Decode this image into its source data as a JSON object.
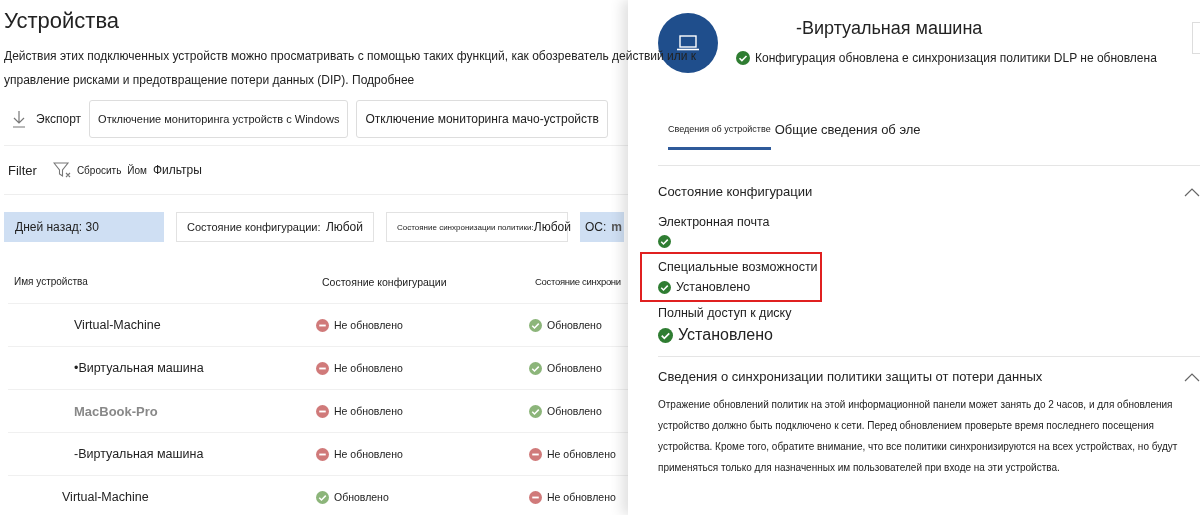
{
  "page": {
    "title": "Устройства",
    "description_lines": [
      "Действия этих подключенных устройств можно просматривать с помощью таких функций, как обозреватель действий или к",
      "управление рисками и предотвращение потери данных (DIP). Подробнее"
    ]
  },
  "toolbar": {
    "export": "Экспорт",
    "buttons": [
      "Отключение мониторинга устройств с Windows",
      "Отключение мониторинга мачо-устройств"
    ]
  },
  "filter_bar": {
    "label": "Filter",
    "reset": "Сбросить",
    "extra": "Йом",
    "filters": "Фильтры"
  },
  "chips": [
    {
      "kind": "plain",
      "label": "Дней назад: 30",
      "selected": true
    },
    {
      "kind": "dropdown",
      "label": "Состояние конфигурации:",
      "value": "Любой",
      "selected": false
    },
    {
      "kind": "dropdown",
      "label": "Состояние синхронизации политики:",
      "value": "Любой",
      "selected": false
    },
    {
      "kind": "plain",
      "label": "ОС:",
      "value": "m",
      "selected": true
    }
  ],
  "table": {
    "columns": [
      "Имя устройства",
      "Состояние конфигурации",
      "Состояние синхрони"
    ],
    "rows": [
      {
        "name": "Virtual-Machine",
        "muted": false,
        "config": {
          "text": "Не обновлено",
          "ok": false
        },
        "sync": {
          "text": "Обновлено",
          "ok": true
        }
      },
      {
        "name": "•Виртуальная машина",
        "muted": false,
        "config": {
          "text": "Не обновлено",
          "ok": false
        },
        "sync": {
          "text": "Обновлено",
          "ok": true
        }
      },
      {
        "name": "MacBook-Pro",
        "muted": true,
        "config": {
          "text": "Не обновлено",
          "ok": false
        },
        "sync": {
          "text": "Обновлено",
          "ok": true
        }
      },
      {
        "name": "-Виртуальная машина",
        "muted": false,
        "config": {
          "text": "Не обновлено",
          "ok": false
        },
        "sync": {
          "text": "Не обновлено",
          "ok": false
        }
      },
      {
        "name": "Virtual-Machine",
        "muted": false,
        "config": {
          "text": "Обновлено",
          "ok": true
        },
        "sync": {
          "text": "Не обновлено",
          "ok": false
        }
      }
    ]
  },
  "panel": {
    "title": "-Виртуальная машина",
    "status": "Конфигурация обновлена е синхронизация политики DLP не обновлена",
    "tabs": [
      {
        "label": "Сведения об устройстве",
        "selected": true
      },
      {
        "label": "Общие сведения об эле",
        "selected": false
      }
    ],
    "sections": [
      {
        "title": "Состояние конфигурации",
        "expanded": true,
        "items": [
          {
            "label": "Электронная почта",
            "ok": true,
            "highlighted": false
          },
          {
            "label": "Специальные возможности",
            "ok": true,
            "value": "Установлено",
            "highlighted": true
          },
          {
            "label": "Полный доступ к диску",
            "ok": true,
            "value": "Установлено",
            "highlighted": false
          }
        ]
      },
      {
        "title": "Сведения о синхронизации политики защиты от потери данных",
        "expanded": true,
        "text": "Отражение обновлений политик на этой информационной панели может занять до 2 часов, и для обновления устройство должно быть подключено к сети. Перед обновлением проверьте время последнего посещения устройства. Кроме того, обратите внимание, что все политики синхронизируются на всех устройствах, но будут применяться только для назначенных им пользователей при входе на эти устройства."
      }
    ]
  }
}
